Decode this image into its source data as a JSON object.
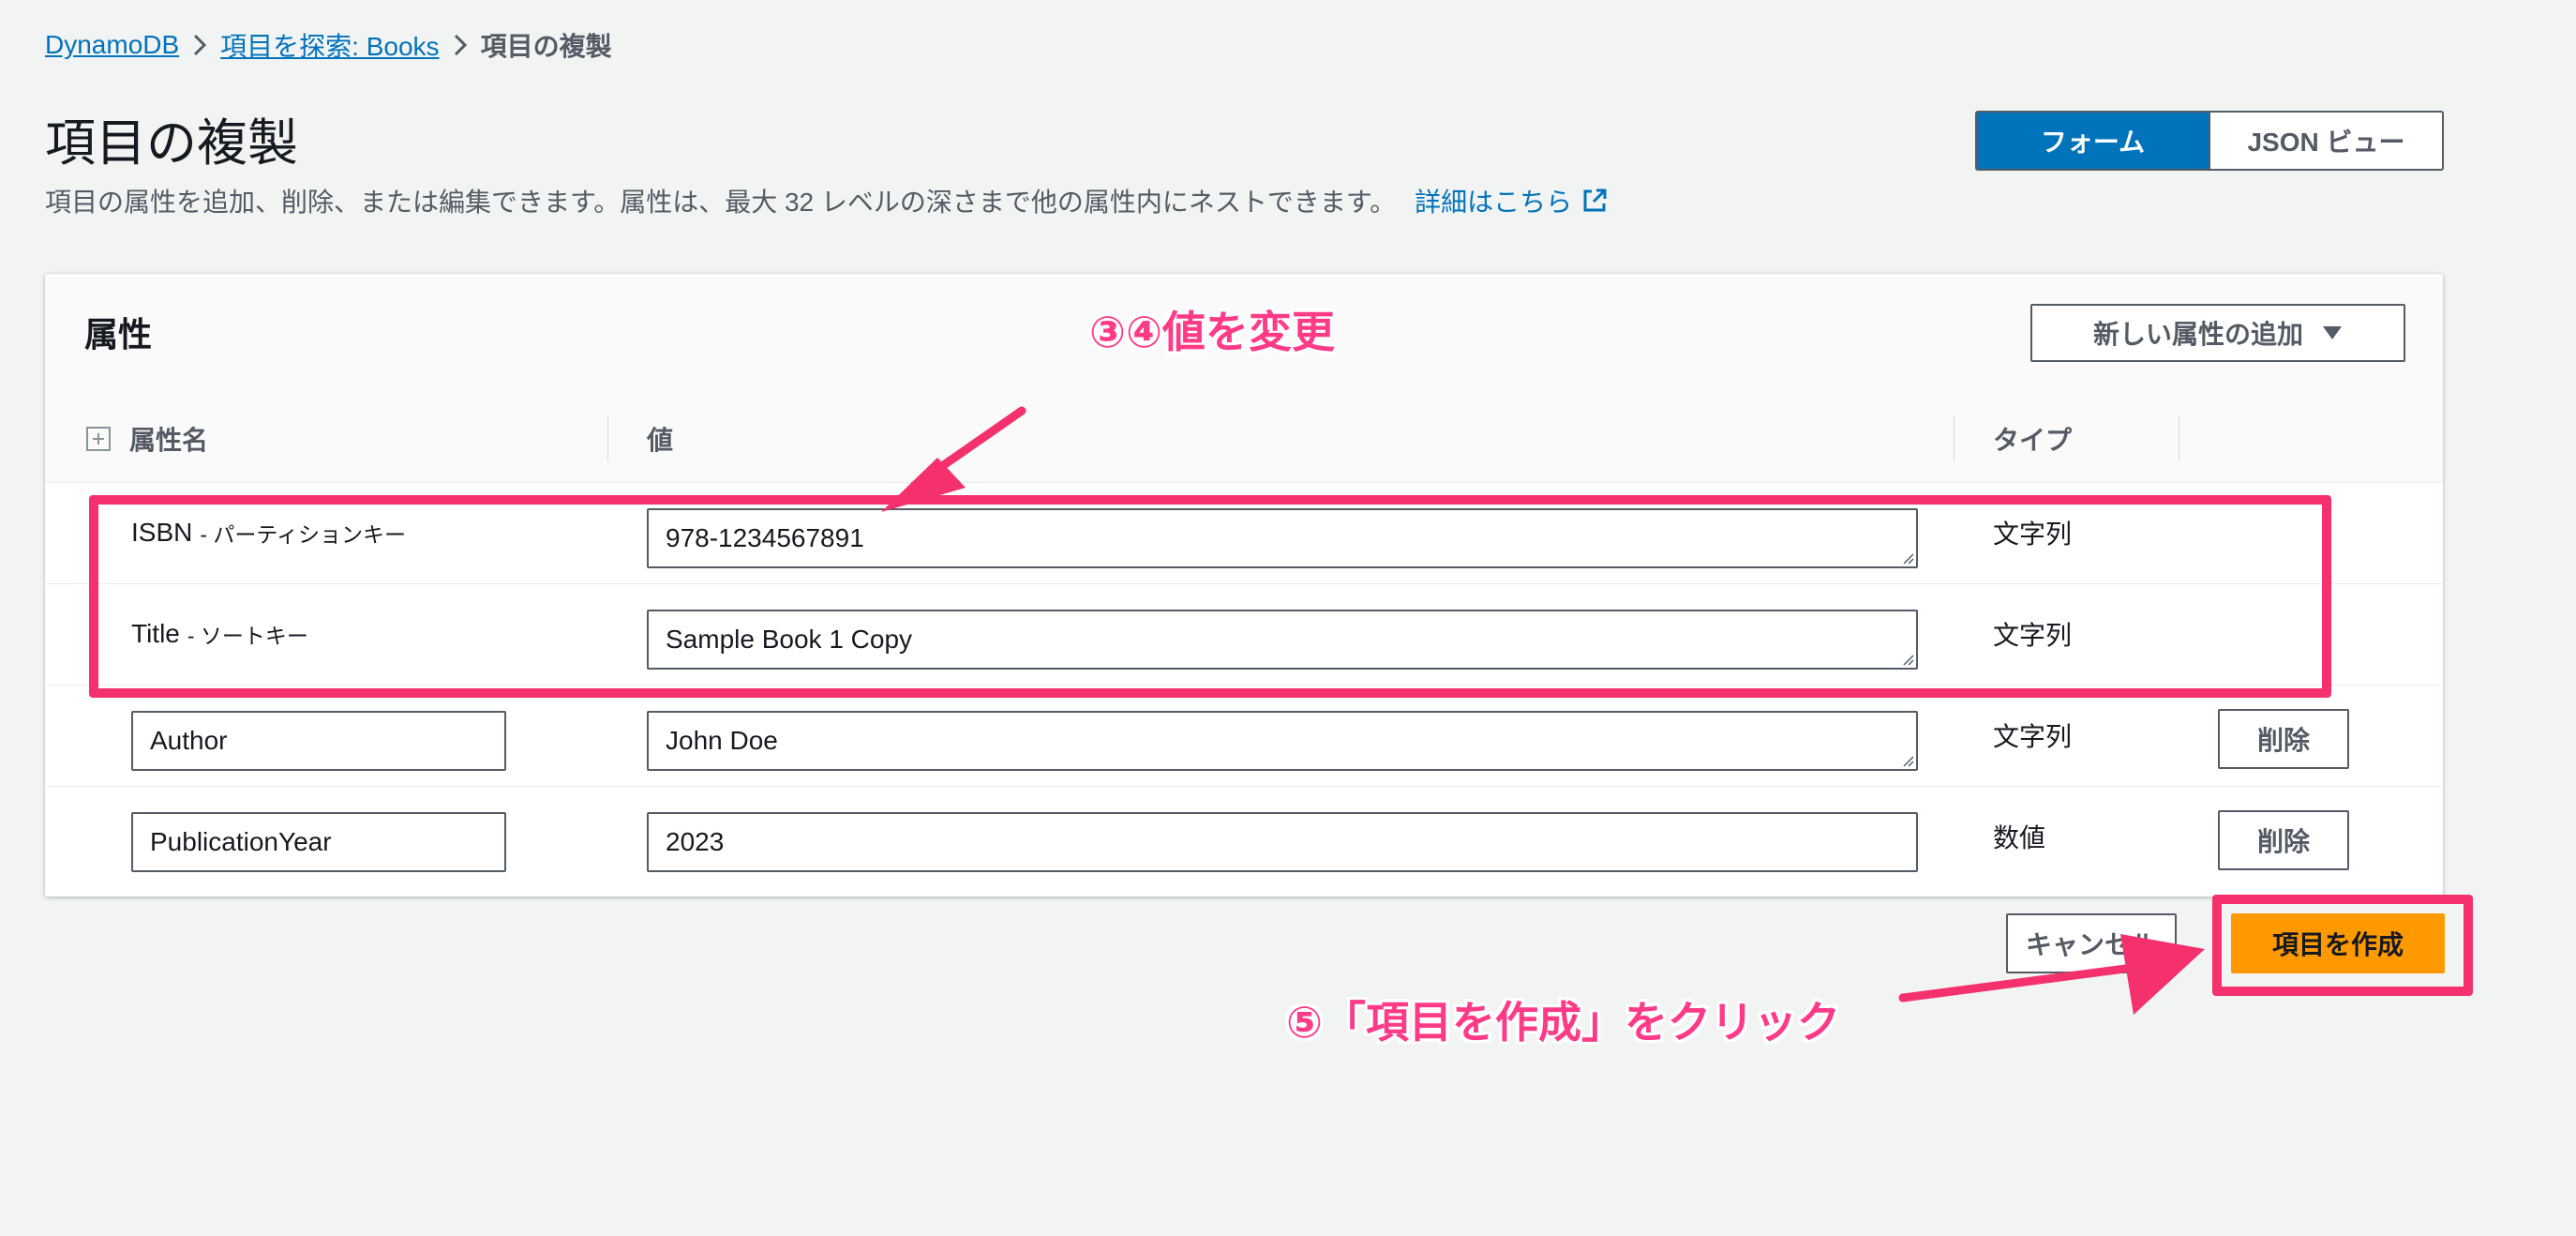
{
  "breadcrumb": {
    "items": [
      "DynamoDB",
      "項目を探索: Books"
    ],
    "current": "項目の複製"
  },
  "page": {
    "title": "項目の複製",
    "description": "項目の属性を追加、削除、または編集できます。属性は、最大 32 レベルの深さまで他の属性内にネストできます。",
    "learn_more": "詳細はこちら"
  },
  "view_toggle": {
    "form": "フォーム",
    "json": "JSON ビュー"
  },
  "panel": {
    "title": "属性",
    "add_attribute": "新しい属性の追加",
    "columns": {
      "name": "属性名",
      "value": "値",
      "type": "タイプ"
    },
    "rows": [
      {
        "name": "ISBN",
        "suffix": "- パーティションキー",
        "value": "978-1234567891",
        "type": "文字列"
      },
      {
        "name": "Title",
        "suffix": "- ソートキー",
        "value": "Sample Book 1 Copy",
        "type": "文字列"
      },
      {
        "name": "Author",
        "value": "John Doe",
        "type": "文字列",
        "delete": "削除"
      },
      {
        "name": "PublicationYear",
        "value": "2023",
        "type": "数値",
        "delete": "削除"
      }
    ]
  },
  "footer": {
    "cancel": "キャンセル",
    "create": "項目を作成"
  },
  "annotations": {
    "step34": "③④値を変更",
    "step5": "⑤「項目を作成」をクリック",
    "color": "#f4306d"
  }
}
